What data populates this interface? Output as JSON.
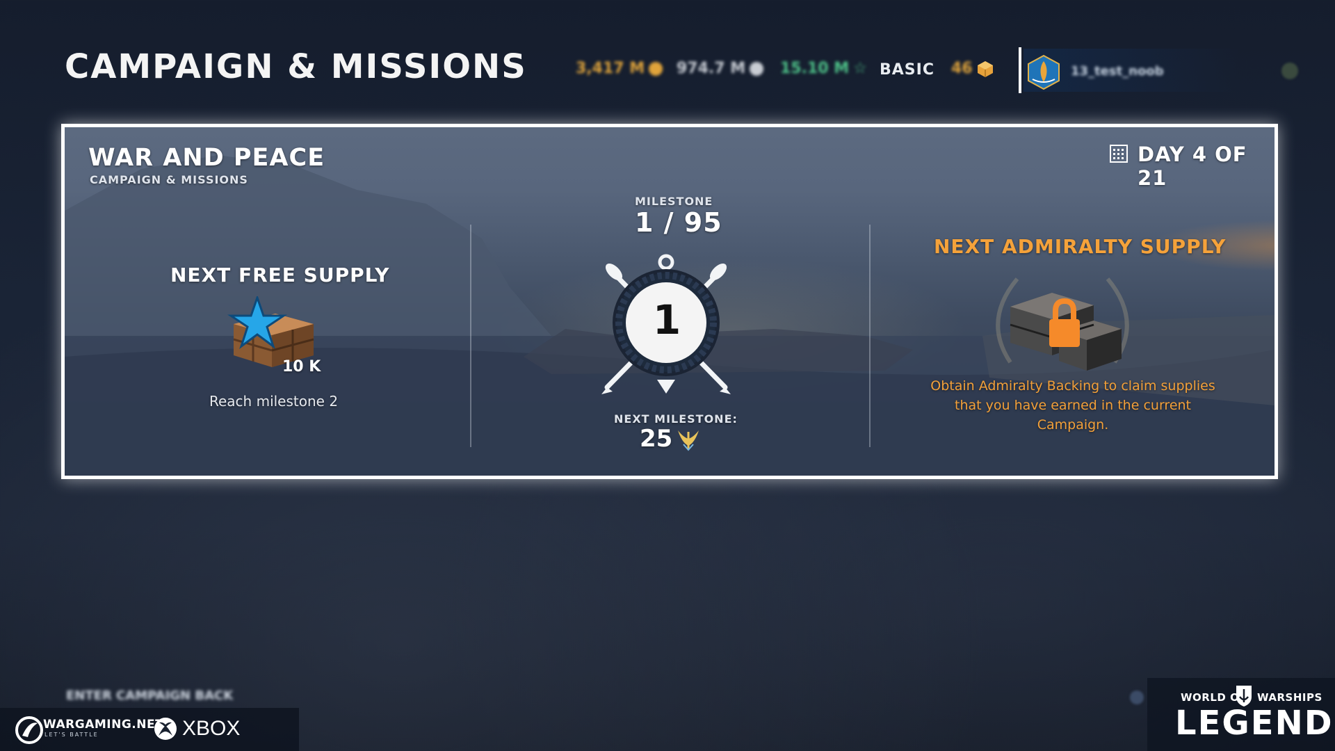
{
  "header": {
    "title": "CAMPAIGN & MISSIONS",
    "currencies": [
      {
        "value": "3,417 M",
        "icon": "credits-icon",
        "color": "#e0a43b"
      },
      {
        "value": "974.7 M",
        "icon": "silver-icon",
        "color": "#c9cdd4"
      },
      {
        "value": "15.10 M",
        "icon": "xp-star-icon",
        "color": "#4fc58a"
      }
    ],
    "account_type": "BASIC",
    "doubloons": {
      "value": "46",
      "icon": "crate-icon",
      "color": "#e0a43b"
    },
    "profile_name": "13_test_noob"
  },
  "campaign": {
    "title": "WAR AND PEACE",
    "subtitle": "CAMPAIGN & MISSIONS",
    "day": "DAY 4 OF 21",
    "free_supply": {
      "title": "NEXT FREE SUPPLY",
      "amount": "10 K",
      "requirement": "Reach milestone 2"
    },
    "milestone": {
      "label": "MILESTONE",
      "progress": "1 / 95",
      "current": "1",
      "next_label": "NEXT MILESTONE:",
      "next_value": "25"
    },
    "admiralty_supply": {
      "title": "NEXT ADMIRALTY SUPPLY",
      "description": "Obtain Admiralty Backing to claim supplies that you have earned in the current Campaign."
    }
  },
  "footer": {
    "hints": "ENTER CAMPAIGN     BACK",
    "wargaming": "WARGAMING.NET",
    "wargaming_tagline": "LET'S BATTLE",
    "xbox": "XBOX",
    "logo_top_left": "WORLD OF",
    "logo_top_right": "WARSHIPS",
    "logo_main": "LEGENDS"
  },
  "colors": {
    "accent_orange": "#f5a23a",
    "star_blue": "#2aa8e8",
    "panel_border": "#ffffff"
  }
}
